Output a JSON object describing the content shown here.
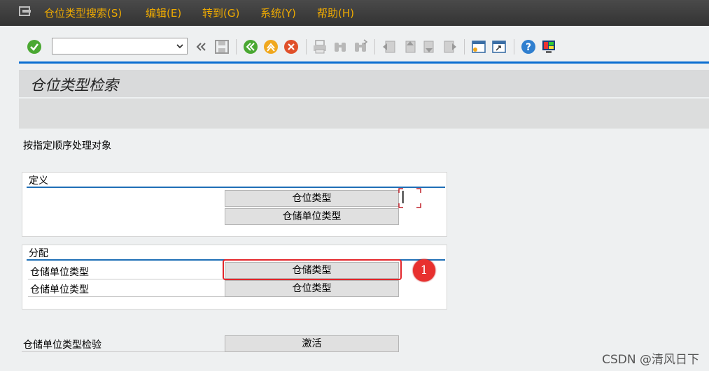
{
  "menubar": {
    "items": [
      {
        "label": "仓位类型搜索(S)"
      },
      {
        "label": "编辑(E)"
      },
      {
        "label": "转到(G)"
      },
      {
        "label": "系统(Y)"
      },
      {
        "label": "帮助(H)"
      }
    ]
  },
  "toolbar": {
    "command_field": {
      "value": "",
      "placeholder": ""
    },
    "icons": [
      "enter-icon",
      "prev-icon",
      "save-icon",
      "back-icon",
      "exit-icon",
      "cancel-icon",
      "print-icon",
      "find-icon",
      "find-next-icon",
      "first-page-icon",
      "prev-page-icon",
      "next-page-icon",
      "last-page-icon",
      "new-session-icon",
      "shortcut-icon",
      "help-icon",
      "layout-icon"
    ]
  },
  "page": {
    "title": "仓位类型检索",
    "instruction": "按指定顺序处理对象"
  },
  "definition": {
    "title": "定义",
    "buttons": [
      "仓位类型",
      "仓储单位类型"
    ]
  },
  "assignment": {
    "title": "分配",
    "rows": [
      {
        "label": "仓储单位类型",
        "button": "仓储类型"
      },
      {
        "label": "仓储单位类型",
        "button": "仓位类型"
      }
    ]
  },
  "check": {
    "label": "仓储单位类型检验",
    "button": "激活"
  },
  "annotation": {
    "badge": "1"
  },
  "watermark": "CSDN @清风日下",
  "colors": {
    "menu_text": "#f0ab00",
    "accent": "#0a6ed1",
    "highlight": "#e3262b"
  }
}
